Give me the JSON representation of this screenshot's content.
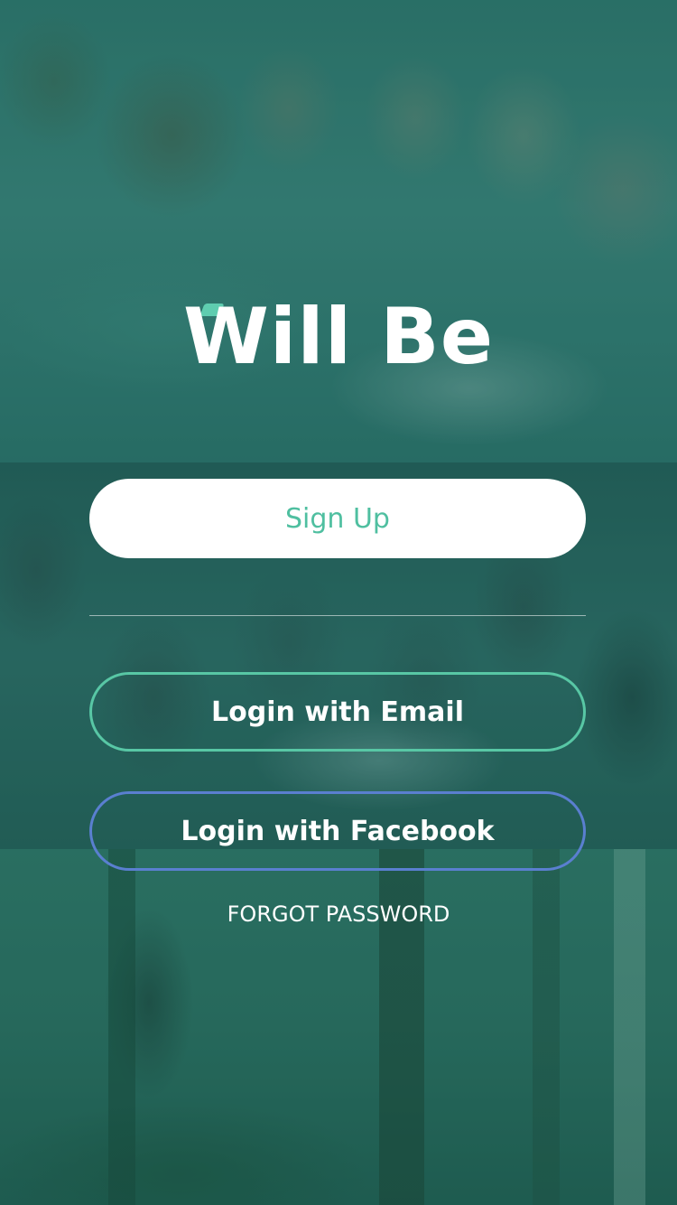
{
  "app": {
    "logo_text": "Will Be",
    "logo_accent_color": "#5fcdb0"
  },
  "auth": {
    "signup_label": "Sign Up",
    "login_email_label": "Login with Email",
    "login_facebook_label": "Login with Facebook",
    "forgot_password_label": "FORGOT PASSWORD"
  },
  "colors": {
    "signup_text": "#4fbfa0",
    "email_border": "#58c7a5",
    "facebook_border": "#5a7fd0",
    "overlay_tint": "#1b6e64"
  }
}
